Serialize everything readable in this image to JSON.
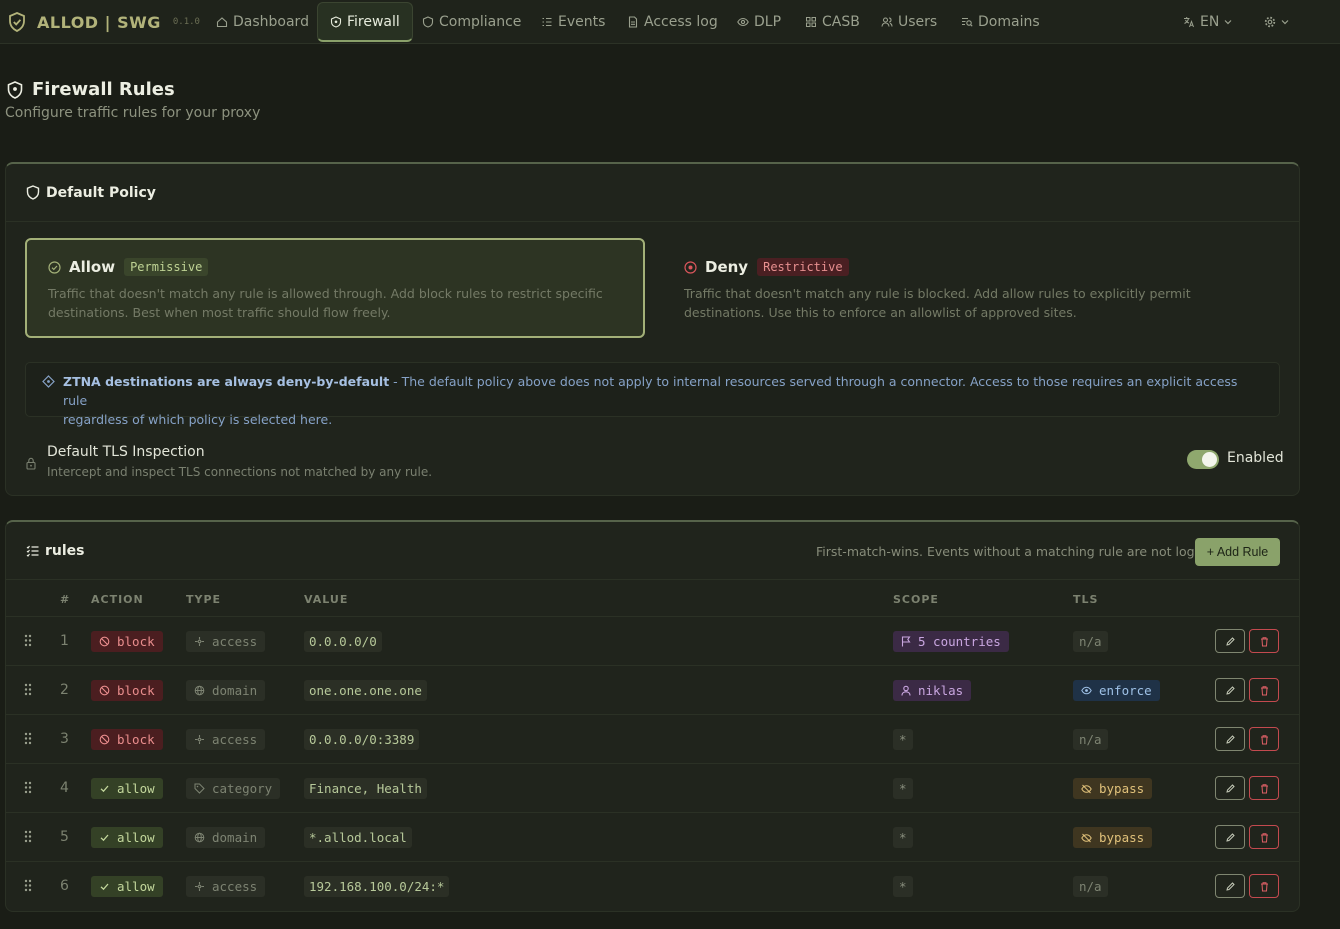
{
  "app": {
    "brand": "ALLOD | SWG",
    "version": "0.1.0"
  },
  "nav": {
    "items": [
      {
        "label": "Dashboard"
      },
      {
        "label": "Firewall"
      },
      {
        "label": "Compliance"
      },
      {
        "label": "Events"
      },
      {
        "label": "Access log"
      },
      {
        "label": "DLP"
      },
      {
        "label": "CASB"
      },
      {
        "label": "Users"
      },
      {
        "label": "Domains"
      }
    ],
    "active": "Firewall",
    "language": "EN"
  },
  "page": {
    "title": "Firewall Rules",
    "subtitle": "Configure traffic rules for your proxy"
  },
  "default_policy": {
    "title": "Default Policy",
    "allow": {
      "name": "Allow",
      "tag": "Permissive",
      "selected": true,
      "line1": "Traffic that doesn't match any rule is allowed through. Add block rules to restrict specific",
      "line2": "destinations. Best when most traffic should flow freely."
    },
    "deny": {
      "name": "Deny",
      "tag": "Restrictive",
      "selected": false,
      "line1": "Traffic that doesn't match any rule is blocked. Add allow rules to explicitly permit",
      "line2": "destinations. Use this to enforce an allowlist of approved sites."
    },
    "ztna": {
      "strong": "ZTNA destinations are always deny-by-default",
      "line1": " - The default policy above does not apply to internal resources served through a connector. Access to those requires an explicit access rule",
      "line2": "regardless of which policy is selected here."
    },
    "tls": {
      "title": "Default TLS Inspection",
      "description": "Intercept and inspect TLS connections not matched by any rule.",
      "enabled": true,
      "state_label": "Enabled"
    }
  },
  "rules": {
    "title": "rules",
    "note": "First-match-wins. Events without a matching rule are not logged.",
    "add_label": "+ Add Rule",
    "columns": [
      "#",
      "ACTION",
      "TYPE",
      "VALUE",
      "SCOPE",
      "TLS"
    ],
    "rows": [
      {
        "num": "1",
        "action": "block",
        "type": "access",
        "value": "0.0.0.0/0",
        "scope": "5 countries",
        "scope_kind": "countries",
        "tls": "n/a",
        "tls_kind": "na"
      },
      {
        "num": "2",
        "action": "block",
        "type": "domain",
        "value": "one.one.one.one",
        "scope": "niklas",
        "scope_kind": "user",
        "tls": "enforce",
        "tls_kind": "enforce"
      },
      {
        "num": "3",
        "action": "block",
        "type": "access",
        "value": "0.0.0.0/0:3389",
        "scope": "*",
        "scope_kind": "all",
        "tls": "n/a",
        "tls_kind": "na"
      },
      {
        "num": "4",
        "action": "allow",
        "type": "category",
        "value": "Finance, Health",
        "scope": "*",
        "scope_kind": "all",
        "tls": "bypass",
        "tls_kind": "bypass"
      },
      {
        "num": "5",
        "action": "allow",
        "type": "domain",
        "value": "*.allod.local",
        "scope": "*",
        "scope_kind": "all",
        "tls": "bypass",
        "tls_kind": "bypass"
      },
      {
        "num": "6",
        "action": "allow",
        "type": "access",
        "value": "192.168.100.0/24:*",
        "scope": "*",
        "scope_kind": "all",
        "tls": "n/a",
        "tls_kind": "na"
      }
    ]
  },
  "colors": {
    "accent": "#8aa26a",
    "block": "#e98d8d",
    "allow": "#c3d79c",
    "ztna": "#86a2c7"
  }
}
